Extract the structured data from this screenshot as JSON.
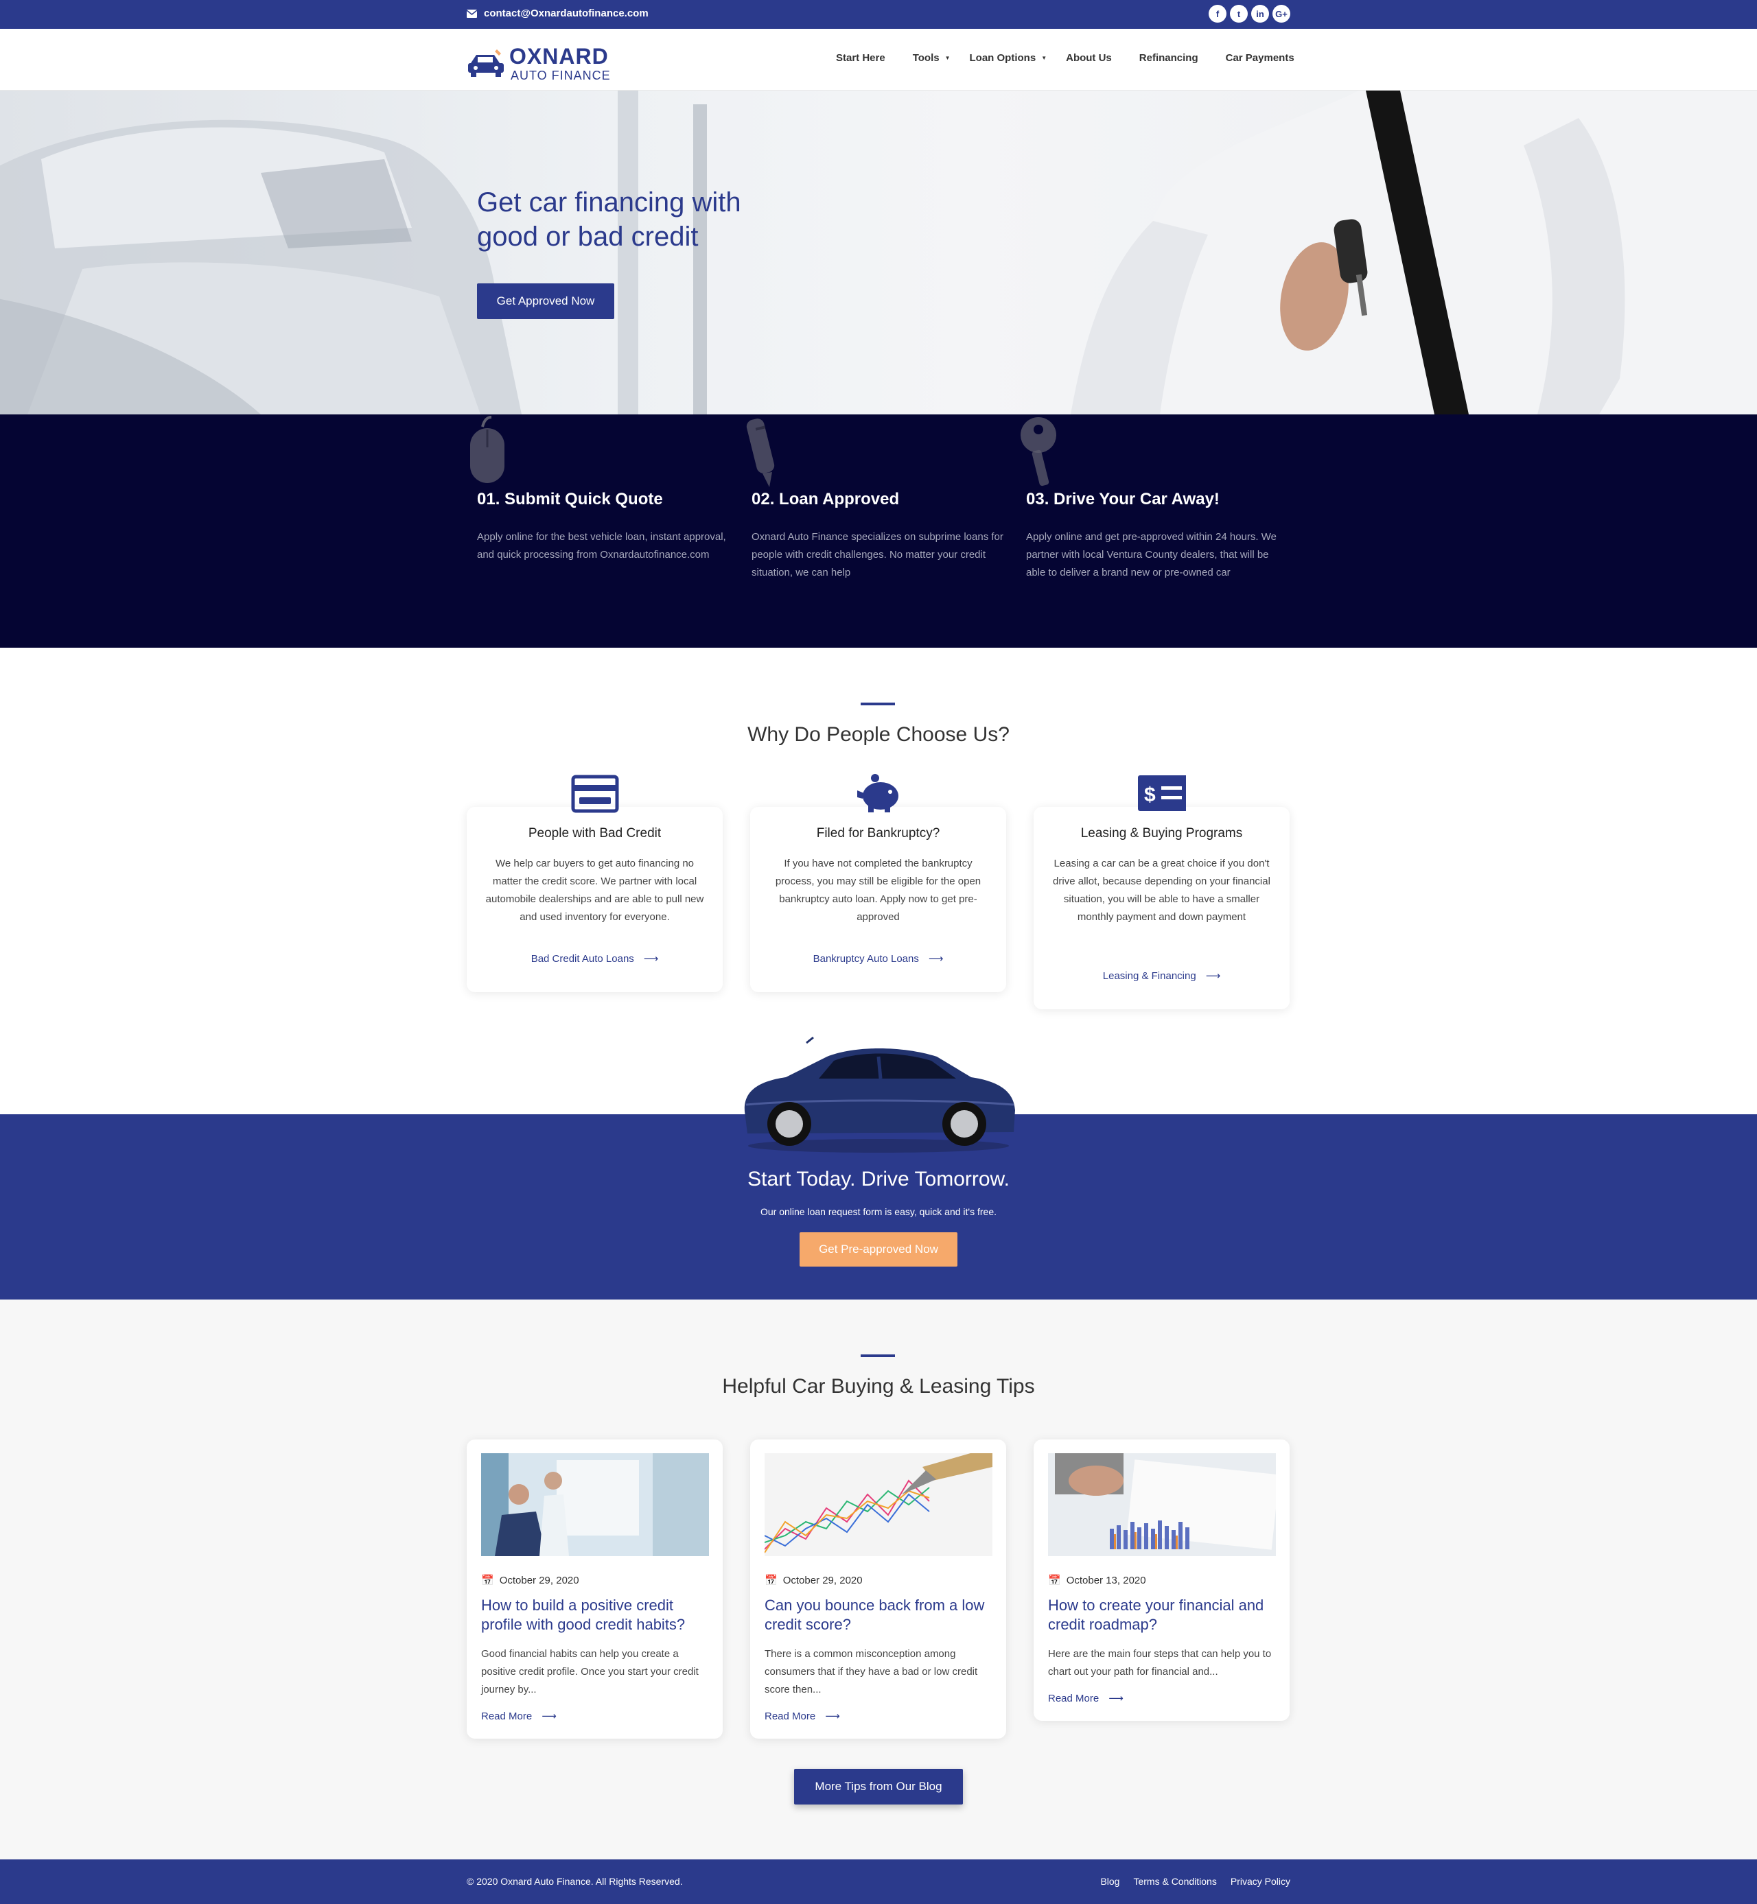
{
  "topbar": {
    "email": "contact@Oxnardautofinance.com",
    "social": [
      {
        "icon": "facebook-icon",
        "glyph": "f"
      },
      {
        "icon": "twitter-icon",
        "glyph": "t"
      },
      {
        "icon": "linkedin-icon",
        "glyph": "in"
      },
      {
        "icon": "google-plus-icon",
        "glyph": "G+"
      }
    ]
  },
  "header": {
    "logo_line1": "OXNARD",
    "logo_line2": "AUTO FINANCE",
    "nav": [
      {
        "label": "Start Here",
        "dropdown": false
      },
      {
        "label": "Tools",
        "dropdown": true
      },
      {
        "label": "Loan Options",
        "dropdown": true
      },
      {
        "label": "About Us",
        "dropdown": false
      },
      {
        "label": "Refinancing",
        "dropdown": false
      },
      {
        "label": "Car Payments",
        "dropdown": false
      }
    ]
  },
  "hero": {
    "title": "Get car financing with good or bad credit",
    "cta": "Get Approved Now"
  },
  "steps": [
    {
      "icon": "mouse-icon",
      "title": "01. Submit Quick Quote",
      "text": "Apply online for the best vehicle loan, instant approval, and quick processing from Oxnardautofinance.com"
    },
    {
      "icon": "pen-icon",
      "title": "02. Loan Approved",
      "text": "Oxnard Auto Finance specializes on subprime loans for people with credit challenges. No matter your credit situation, we can help"
    },
    {
      "icon": "key-icon",
      "title": "03. Drive Your Car Away!",
      "text": "Apply online and get pre-approved within 24 hours. We partner with local Ventura County dealers, that will be able to deliver a brand new or pre-owned car"
    }
  ],
  "why": {
    "heading": "Why Do People Choose Us?",
    "cards": [
      {
        "icon": "credit-card-icon",
        "title": "People with Bad Credit",
        "text": "We help car buyers to get auto financing no matter the credit score. We partner with local automobile dealerships and are able to pull new and used inventory for everyone.",
        "link": "Bad Credit Auto Loans"
      },
      {
        "icon": "piggy-bank-icon",
        "title": "Filed for Bankruptcy?",
        "text": "If you have not completed the bankruptcy process, you may still be eligible for the open bankruptcy auto loan. Apply now to get pre-approved",
        "link": "Bankruptcy Auto Loans"
      },
      {
        "icon": "money-check-icon",
        "title": "Leasing & Buying Programs",
        "text": "Leasing a car can be a great choice if you don't drive allot, because depending on your financial situation, you will be able to have a smaller monthly payment and down payment",
        "link": "Leasing & Financing"
      }
    ]
  },
  "band": {
    "heading": "Start Today. Drive Tomorrow.",
    "subtext": "Our online loan request form is easy, quick and it's free.",
    "cta": "Get Pre-approved Now"
  },
  "tips": {
    "heading": "Helpful Car Buying & Leasing Tips",
    "posts": [
      {
        "date": "October 29, 2020",
        "title": "How to build a positive credit profile with good credit habits?",
        "excerpt": "Good financial habits can help you create a positive credit profile. Once you start your credit journey by...",
        "read_more": "Read More"
      },
      {
        "date": "October 29, 2020",
        "title": "Can you bounce back from a low credit score?",
        "excerpt": "There is a common misconception among consumers that if they have a bad or low credit score then...",
        "read_more": "Read More"
      },
      {
        "date": "October 13, 2020",
        "title": "How to create your financial and credit roadmap?",
        "excerpt": "Here are the main four steps that can help you to chart out your path for financial and...",
        "read_more": "Read More"
      }
    ],
    "more_button": "More Tips from Our Blog"
  },
  "footer": {
    "copyright": "© 2020 Oxnard Auto Finance. All Rights Reserved.",
    "links": [
      "Blog",
      "Terms & Conditions",
      "Privacy Policy"
    ]
  },
  "colors": {
    "brand": "#2b3a8c",
    "dark": "#050533",
    "accent": "#f6a96b"
  }
}
